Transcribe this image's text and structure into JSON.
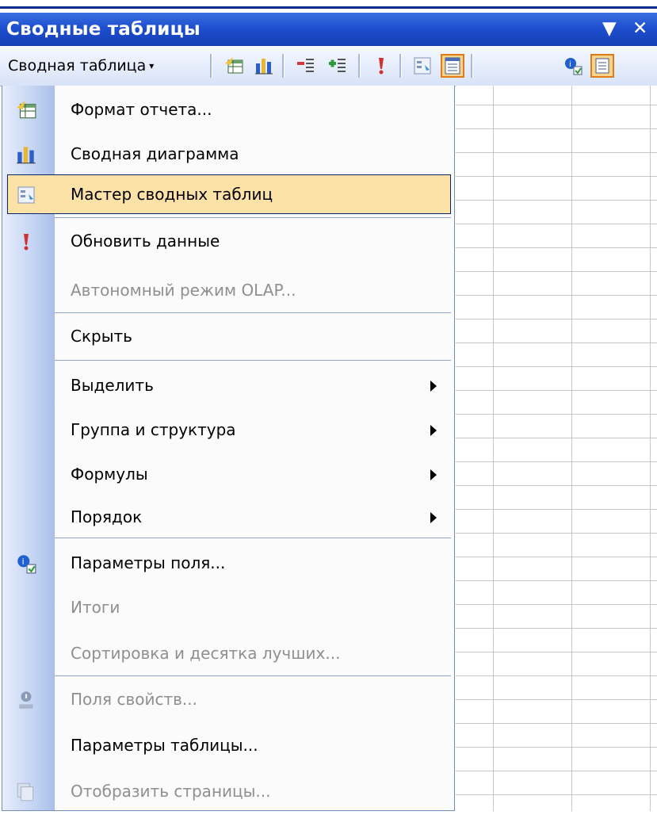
{
  "window": {
    "title": "Сводные таблицы",
    "dropdown_glyph": "▼",
    "close_glyph": "✕"
  },
  "toolbar": {
    "menu_label": "Сводная таблица",
    "menu_arrow": "▾",
    "buttons": [
      {
        "name": "format-report-icon"
      },
      {
        "name": "pivot-chart-icon"
      },
      {
        "name": "hide-detail-icon"
      },
      {
        "name": "show-detail-icon"
      },
      {
        "name": "refresh-icon"
      },
      {
        "name": "wizard-icon"
      },
      {
        "name": "field-list-icon"
      },
      {
        "name": "field-settings-icon"
      },
      {
        "name": "options-icon"
      }
    ]
  },
  "menu": {
    "items": [
      {
        "label": "Формат отчета...",
        "icon": "format-report-icon",
        "enabled": true
      },
      {
        "label": "Сводная диаграмма",
        "icon": "pivot-chart-icon",
        "enabled": true
      },
      {
        "label": "Мастер сводных таблиц",
        "icon": "wizard-icon",
        "enabled": true,
        "selected": true
      },
      {
        "label": "Обновить данные",
        "icon": "refresh-icon",
        "enabled": true
      },
      {
        "label": "Автономный режим OLAP...",
        "icon": null,
        "enabled": false
      },
      {
        "label": "Скрыть",
        "icon": null,
        "enabled": true
      },
      {
        "label": "Выделить",
        "icon": null,
        "enabled": true,
        "submenu": true
      },
      {
        "label": "Группа и структура",
        "icon": null,
        "enabled": true,
        "submenu": true
      },
      {
        "label": "Формулы",
        "icon": null,
        "enabled": true,
        "submenu": true
      },
      {
        "label": "Порядок",
        "icon": null,
        "enabled": true,
        "submenu": true
      },
      {
        "label": "Параметры поля...",
        "icon": "field-settings-icon",
        "enabled": true
      },
      {
        "label": "Итоги",
        "icon": null,
        "enabled": false
      },
      {
        "label": "Сортировка и десятка лучших...",
        "icon": null,
        "enabled": false
      },
      {
        "label": "Поля свойств...",
        "icon": "property-fields-icon",
        "enabled": false
      },
      {
        "label": "Параметры таблицы...",
        "icon": null,
        "enabled": true
      },
      {
        "label": "Отобразить страницы...",
        "icon": "show-pages-icon",
        "enabled": false
      }
    ]
  },
  "colors": {
    "titlebar": "#1f4fcf",
    "selection_fill": "#fde2a8",
    "selection_border": "#0a246a",
    "highlight_button": "#e07b19"
  }
}
